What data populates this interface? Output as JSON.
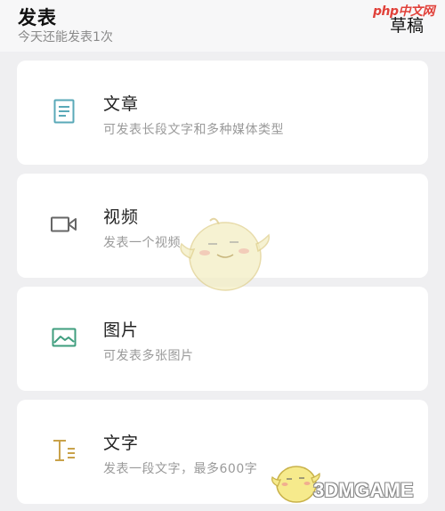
{
  "header": {
    "title": "发表",
    "subtitle": "今天还能发表1次",
    "draft_label": "草稿"
  },
  "cards": [
    {
      "title": "文章",
      "desc": "可发表长段文字和多种媒体类型",
      "icon": "document-icon",
      "color": "#5aa9b8"
    },
    {
      "title": "视频",
      "desc": "发表一个视频",
      "icon": "video-camera-icon",
      "color": "#666666"
    },
    {
      "title": "图片",
      "desc": "可发表多张图片",
      "icon": "image-icon",
      "color": "#3f9e7e"
    },
    {
      "title": "文字",
      "desc": "发表一段文字，最多600字",
      "icon": "text-icon",
      "color": "#c9a24a"
    }
  ],
  "watermarks": {
    "top": "php中文网",
    "bottom": "3DMGAME"
  }
}
